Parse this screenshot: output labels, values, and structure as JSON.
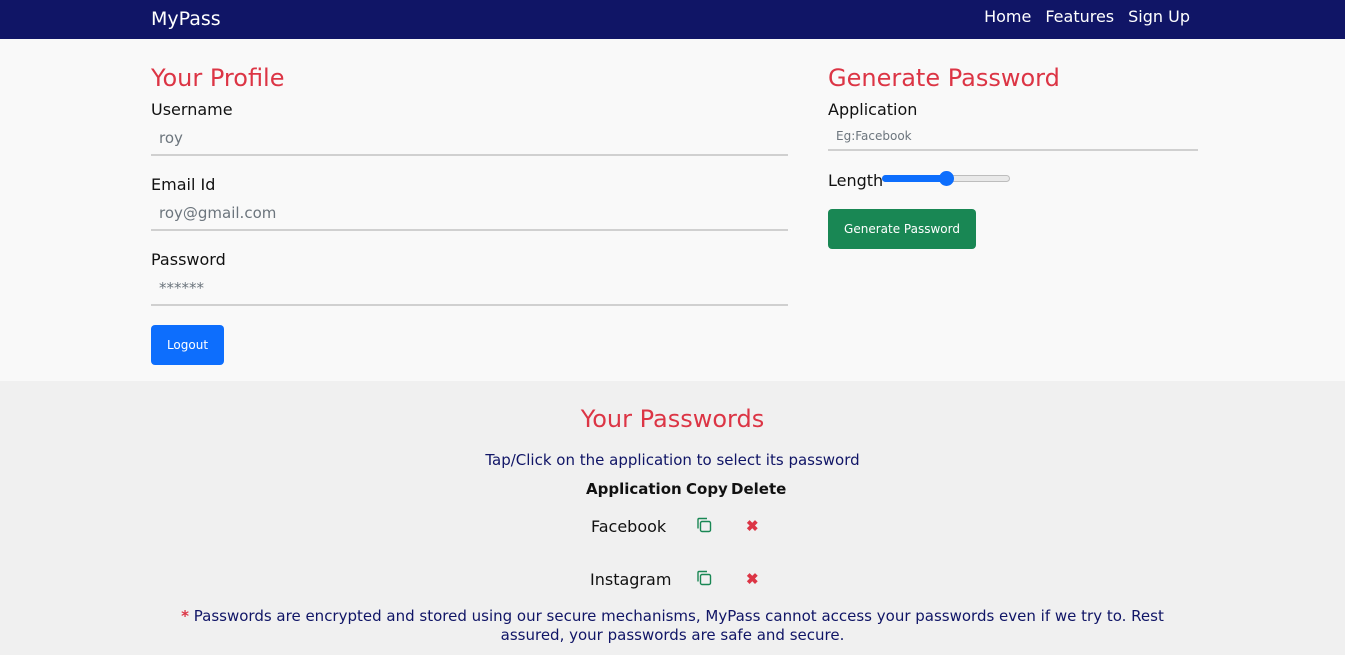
{
  "nav": {
    "brand": "MyPass",
    "links": [
      "Home",
      "Features",
      "Sign Up"
    ]
  },
  "profile": {
    "title": "Your Profile",
    "username_label": "Username",
    "username_value": "roy",
    "email_label": "Email Id",
    "email_value": "roy@gmail.com",
    "password_label": "Password",
    "password_value": "******",
    "logout_label": "Logout"
  },
  "generator": {
    "title": "Generate Password",
    "application_label": "Application",
    "application_placeholder": "Eg:Facebook",
    "length_label": "Length",
    "length_slider_fraction": 0.5,
    "generate_label": "Generate Password"
  },
  "passwords": {
    "title": "Your Passwords",
    "subtitle": "Tap/Click on the application to select its password",
    "columns": [
      "Application",
      "Copy",
      "Delete"
    ],
    "rows": [
      {
        "application": "Facebook"
      },
      {
        "application": "Instagram"
      }
    ],
    "footnote_asterisk": "*",
    "footnote": "Passwords are encrypted and stored using our secure mechanisms, MyPass cannot access your passwords even if we try to. Rest assured, your passwords are safe and secure."
  },
  "colors": {
    "navbar": "#101566",
    "heading": "#dc3545",
    "primary": "#0d6efd",
    "success": "#198754"
  },
  "icons": {
    "copy": "copy-icon",
    "delete": "close-icon"
  }
}
